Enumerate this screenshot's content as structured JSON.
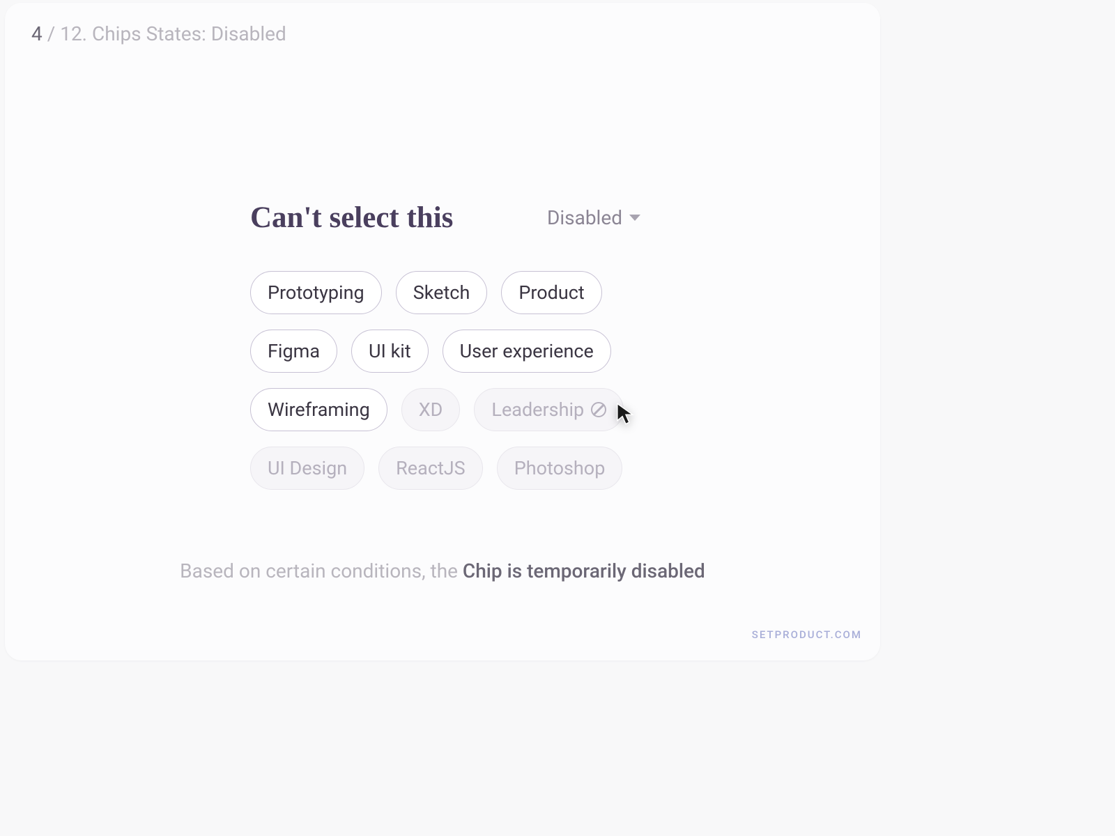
{
  "breadcrumb": {
    "current": "4",
    "separator": " / ",
    "total": "12. Chips States: Disabled"
  },
  "header": {
    "title": "Can't select this",
    "dropdown_label": "Disabled"
  },
  "chips": {
    "row1": [
      {
        "label": "Prototyping",
        "state": "normal"
      },
      {
        "label": "Sketch",
        "state": "normal"
      },
      {
        "label": "Product",
        "state": "normal"
      }
    ],
    "row2": [
      {
        "label": "Figma",
        "state": "normal"
      },
      {
        "label": "UI kit",
        "state": "normal"
      },
      {
        "label": "User experience",
        "state": "normal"
      }
    ],
    "row3": [
      {
        "label": "Wireframing",
        "state": "normal"
      },
      {
        "label": "XD",
        "state": "disabled"
      },
      {
        "label": "Leadership",
        "state": "disabled-highlight"
      }
    ],
    "row4": [
      {
        "label": "UI Design",
        "state": "disabled"
      },
      {
        "label": "ReactJS",
        "state": "disabled"
      },
      {
        "label": "Photoshop",
        "state": "disabled"
      }
    ]
  },
  "caption": {
    "prefix": "Based on certain conditions, the ",
    "emphasis": "Chip is temporarily disabled"
  },
  "watermark": "SETPRODUCT.COM"
}
